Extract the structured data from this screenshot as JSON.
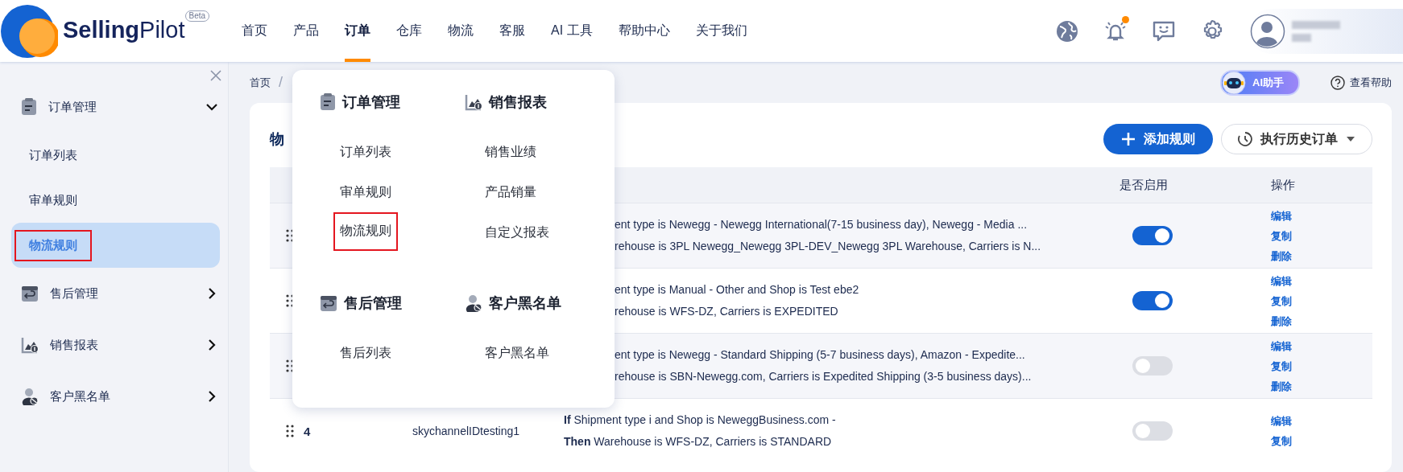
{
  "header": {
    "logo": "**Selling**Pilot",
    "badge": "Beta",
    "nav": [
      {
        "label": "首页",
        "selected": false
      },
      {
        "label": "产品",
        "selected": false
      },
      {
        "label": "订单",
        "selected": true
      },
      {
        "label": "仓库",
        "selected": false
      },
      {
        "label": "物流",
        "selected": false
      },
      {
        "label": "客服",
        "selected": false
      },
      {
        "label": "AI 工具",
        "selected": false
      },
      {
        "label": "帮助中心",
        "selected": false
      },
      {
        "label": "关于我们",
        "selected": false
      }
    ],
    "notification_dot": true
  },
  "sidebar": {
    "items": [
      {
        "label": "订单管理",
        "expanded": true,
        "children": [
          {
            "label": "订单列表",
            "selected": false,
            "highlighted": false
          },
          {
            "label": "审单规则",
            "selected": false,
            "highlighted": false
          },
          {
            "label": "物流规则",
            "selected": true,
            "highlighted": true
          }
        ]
      },
      {
        "label": "售后管理",
        "expanded": false
      },
      {
        "label": "销售报表",
        "expanded": false
      },
      {
        "label": "客户黑名单",
        "expanded": false
      }
    ]
  },
  "breadcrumb": {
    "items": [
      "首页"
    ],
    "separator": "/"
  },
  "toolbar": {
    "ai_assistant": "AI助手",
    "help": "查看帮助"
  },
  "panel": {
    "title": "物",
    "buttons": [
      {
        "kind": "primary",
        "label": "添加规则"
      },
      {
        "kind": "dropdown",
        "label": "执行历史订单"
      }
    ],
    "table": {
      "columns": [
        "是否启用",
        "操作"
      ],
      "rows": [
        {
          "condition": [
            "ent type is Newegg - Newegg International(7-15 business day), Newegg - Media ...",
            "rehouse is 3PL Newegg_Newegg 3PL-DEV_Newegg 3PL Warehouse, Carriers is N..."
          ],
          "enabled": true,
          "actions": [
            "编辑",
            "复制",
            "删除"
          ]
        },
        {
          "condition": [
            "ent type is Manual - Other and Shop is Test ebe2",
            "rehouse is WFS-DZ, Carriers is EXPEDITED"
          ],
          "enabled": true,
          "actions": [
            "编辑",
            "复制",
            "删除"
          ]
        },
        {
          "condition": [
            "ent type is Newegg - Standard Shipping (5-7 business days), Amazon - Expedite...",
            "rehouse is SBN-Newegg.com, Carriers is Expedited Shipping (3-5 business days)..."
          ],
          "enabled": false,
          "actions": [
            "编辑",
            "复制",
            "删除"
          ]
        },
        {
          "priority": "4",
          "name": "skychannelIDtesting1",
          "condition": [
            "**If** Shipment type i and Shop is NeweggBusiness.com -",
            "**Then** Warehouse is WFS-DZ, Carriers is STANDARD"
          ],
          "enabled": false,
          "actions": [
            "编辑",
            "复制"
          ]
        }
      ]
    }
  },
  "mega_menu": {
    "sections": [
      {
        "title": "订单管理",
        "items": [
          {
            "label": "订单列表",
            "highlighted": false
          },
          {
            "label": "审单规则",
            "highlighted": false
          },
          {
            "label": "物流规则",
            "highlighted": true
          }
        ]
      },
      {
        "title": "销售报表",
        "items": [
          {
            "label": "销售业绩",
            "highlighted": false
          },
          {
            "label": "产品销量",
            "highlighted": false
          },
          {
            "label": "自定义报表",
            "highlighted": false
          }
        ]
      },
      {
        "title": "售后管理",
        "items": [
          {
            "label": "售后列表",
            "highlighted": false
          }
        ]
      },
      {
        "title": "客户黑名单",
        "items": [
          {
            "label": "客户黑名单",
            "highlighted": false
          }
        ]
      }
    ]
  }
}
